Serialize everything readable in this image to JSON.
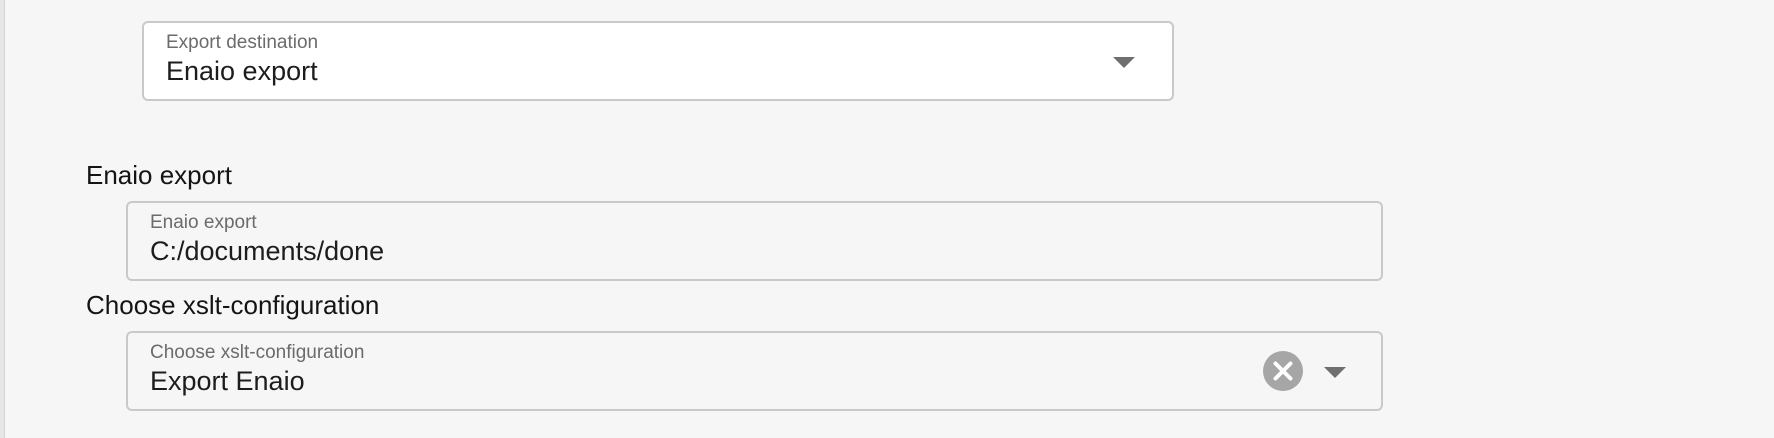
{
  "export_destination": {
    "label": "Export destination",
    "value": "Enaio export"
  },
  "enaio_section": {
    "heading": "Enaio export",
    "field_label": "Enaio export",
    "field_value": "C:/documents/done"
  },
  "xslt_section": {
    "heading": "Choose xslt-configuration",
    "field_label": "Choose xslt-configuration",
    "field_value": "Export Enaio"
  },
  "icons": {
    "dropdown": "chevron-down-icon",
    "clear": "clear-icon"
  },
  "colors": {
    "background": "#f6f6f6",
    "border": "#c9c9c9",
    "icon": "#a6a6a6"
  }
}
